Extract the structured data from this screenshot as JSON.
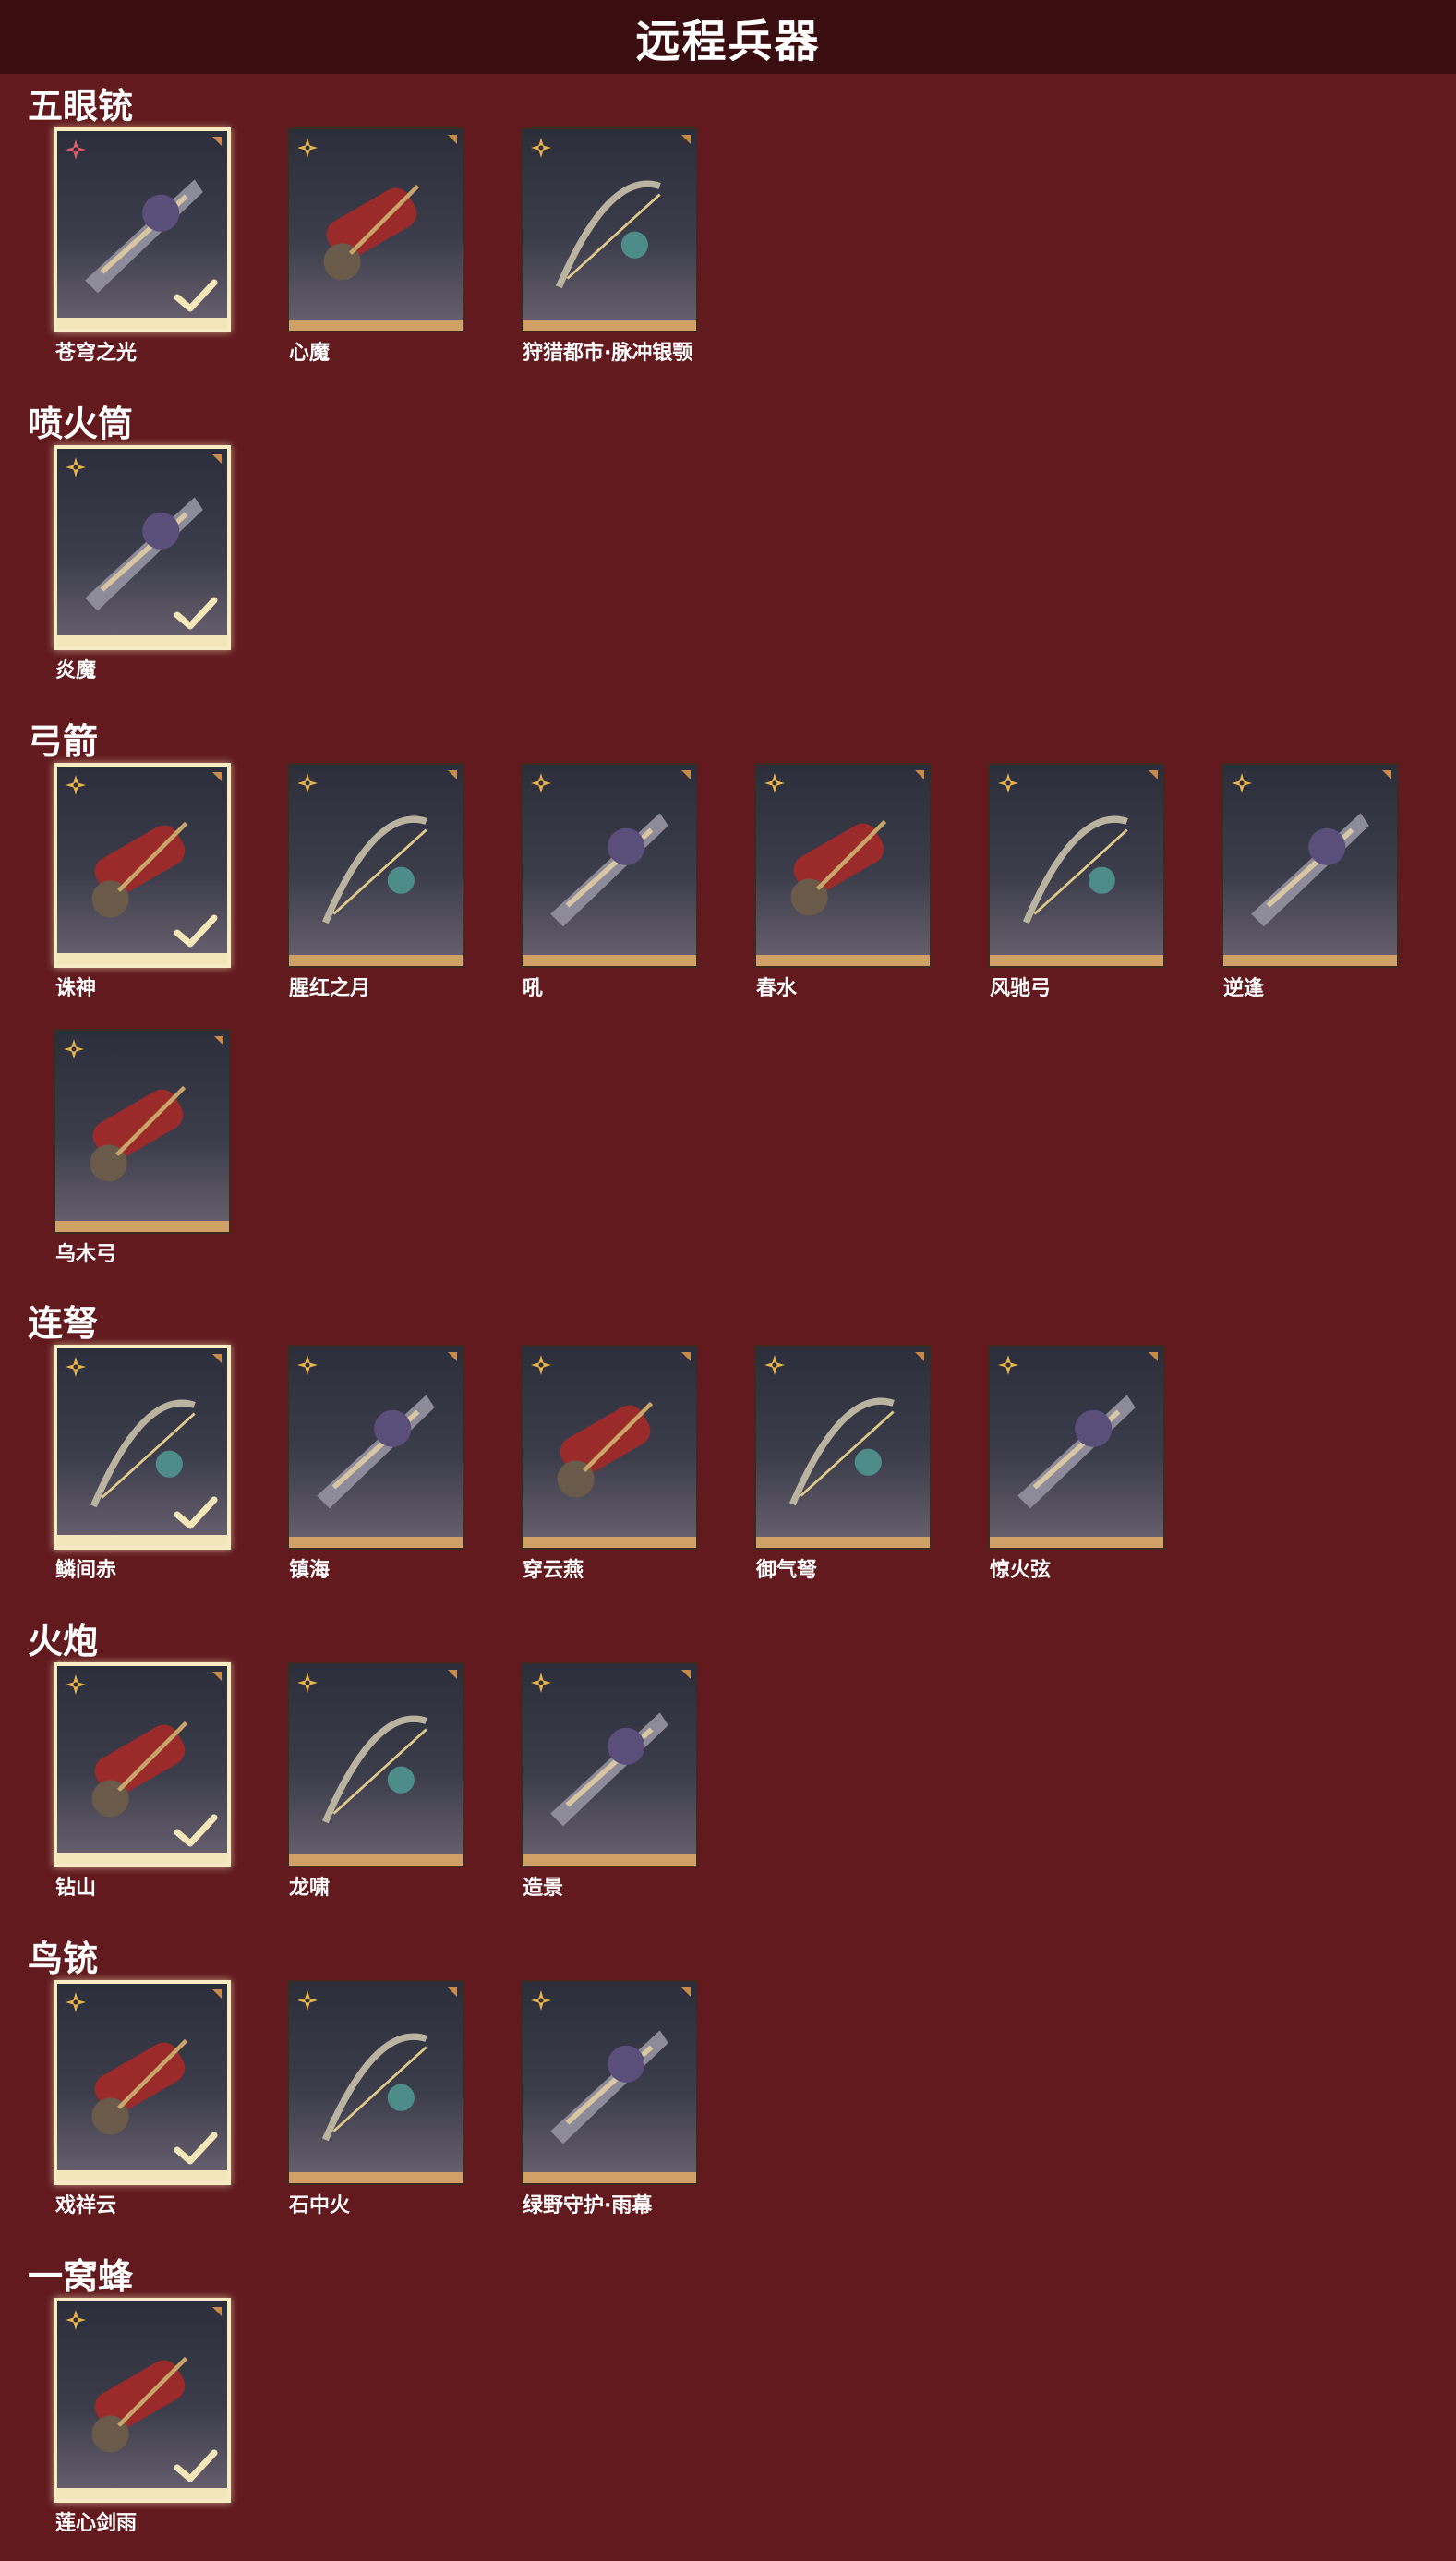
{
  "page": {
    "title": "远程兵器"
  },
  "colors": {
    "background": "#621a1e",
    "header": "#3a0d10",
    "card_base": "#d1a066",
    "selected_border": "#f5ecc4"
  },
  "sections": [
    {
      "title": "五眼铳",
      "items": [
        {
          "name": "苍穹之光",
          "selected": true,
          "rarity_icon": "red-star-icon"
        },
        {
          "name": "心魔",
          "selected": false,
          "rarity_icon": "gold-star-icon"
        },
        {
          "name": "狩猎都市·脉冲银颚",
          "selected": false,
          "rarity_icon": "gold-star-icon"
        }
      ]
    },
    {
      "title": "喷火筒",
      "items": [
        {
          "name": "炎魔",
          "selected": true,
          "rarity_icon": "gold-star-icon"
        }
      ]
    },
    {
      "title": "弓箭",
      "items": [
        {
          "name": "诛神",
          "selected": true,
          "rarity_icon": "gold-star-icon"
        },
        {
          "name": "腥红之月",
          "selected": false,
          "rarity_icon": "gold-star-icon"
        },
        {
          "name": "吼",
          "selected": false,
          "rarity_icon": "gold-star-icon"
        },
        {
          "name": "春水",
          "selected": false,
          "rarity_icon": "gold-star-icon"
        },
        {
          "name": "风驰弓",
          "selected": false,
          "rarity_icon": "gold-star-icon"
        },
        {
          "name": "逆逢",
          "selected": false,
          "rarity_icon": "gold-star-icon"
        },
        {
          "name": "乌木弓",
          "selected": false,
          "rarity_icon": "gold-star-icon"
        }
      ]
    },
    {
      "title": "连弩",
      "items": [
        {
          "name": "鳞间赤",
          "selected": true,
          "rarity_icon": "gold-star-icon"
        },
        {
          "name": "镇海",
          "selected": false,
          "rarity_icon": "gold-star-icon"
        },
        {
          "name": "穿云燕",
          "selected": false,
          "rarity_icon": "gold-star-icon"
        },
        {
          "name": "御气弩",
          "selected": false,
          "rarity_icon": "gold-star-icon"
        },
        {
          "name": "惊火弦",
          "selected": false,
          "rarity_icon": "gold-star-icon"
        }
      ]
    },
    {
      "title": "火炮",
      "items": [
        {
          "name": "钻山",
          "selected": true,
          "rarity_icon": "gold-star-icon"
        },
        {
          "name": "龙啸",
          "selected": false,
          "rarity_icon": "gold-star-icon"
        },
        {
          "name": "造景",
          "selected": false,
          "rarity_icon": "gold-star-icon"
        }
      ]
    },
    {
      "title": "鸟铳",
      "items": [
        {
          "name": "戏祥云",
          "selected": true,
          "rarity_icon": "gold-star-icon"
        },
        {
          "name": "石中火",
          "selected": false,
          "rarity_icon": "gold-star-icon"
        },
        {
          "name": "绿野守护·雨幕",
          "selected": false,
          "rarity_icon": "gold-star-icon"
        }
      ]
    },
    {
      "title": "一窝蜂",
      "items": [
        {
          "name": "莲心剑雨",
          "selected": true,
          "rarity_icon": "gold-star-icon"
        }
      ]
    }
  ]
}
